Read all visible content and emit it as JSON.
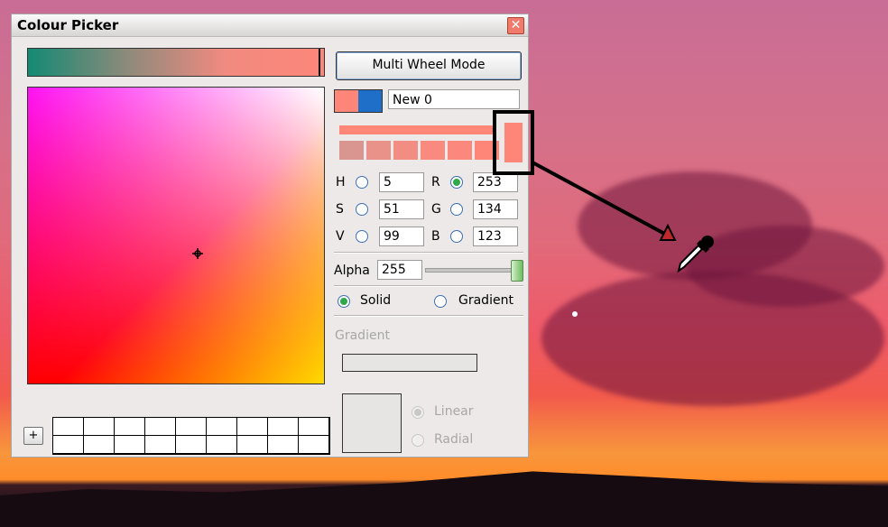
{
  "window": {
    "title": "Colour Picker",
    "close_label": "✕"
  },
  "buttons": {
    "multi_wheel": "Multi Wheel Mode",
    "add_swatch": "+"
  },
  "colour": {
    "name": "New 0",
    "H": "5",
    "S": "51",
    "V": "99",
    "R": "253",
    "G": "134",
    "B": "123",
    "alpha_label": "Alpha",
    "alpha": "255",
    "primary_hex": "#fd8679",
    "secondary_hex": "#1f6fc8"
  },
  "labels": {
    "H": "H",
    "S": "S",
    "V": "V",
    "R": "R",
    "G": "G",
    "B": "B"
  },
  "fill": {
    "solid": "Solid",
    "gradient": "Gradient",
    "selected": "Solid"
  },
  "gradient_section": {
    "heading": "Gradient",
    "linear": "Linear",
    "radial": "Radial",
    "selected": "Linear"
  },
  "channel_selected": "R",
  "tints": [
    "#d99690",
    "#e99289",
    "#f28d83",
    "#f88a80",
    "#fb887d",
    "#fd8679"
  ],
  "icons": {
    "picker_cursor": "crosshair-icon",
    "eyedropper": "eyedropper-icon",
    "callout_arrow": "arrow-icon"
  }
}
